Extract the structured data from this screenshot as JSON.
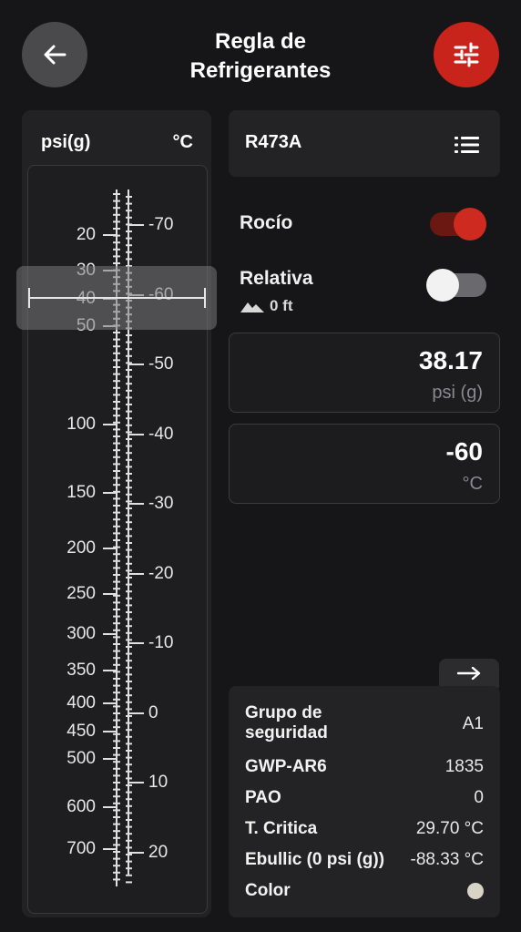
{
  "header": {
    "title_line1": "Regla de",
    "title_line2": "Refrigerantes",
    "back_icon": "arrow-left-icon",
    "settings_icon": "sliders-icon"
  },
  "ruler": {
    "pressure_unit": "psi(g)",
    "temp_unit": "°C",
    "pressure_labels": [
      "20",
      "30",
      "40",
      "50",
      "100",
      "150",
      "200",
      "250",
      "300",
      "350",
      "400",
      "450",
      "500",
      "600",
      "700"
    ],
    "temp_labels": [
      "-70",
      "-60",
      "-50",
      "-40",
      "-30",
      "-20",
      "-10",
      "0",
      "10",
      "20"
    ]
  },
  "refrigerant": {
    "name": "R473A",
    "list_icon": "list-icon"
  },
  "toggles": {
    "dew_label": "Rocío",
    "dew_on": true,
    "relative_label": "Relativa",
    "relative_on": false,
    "altitude_icon": "mountain-icon",
    "altitude": "0 ft"
  },
  "readings": {
    "pressure_value": "38.17",
    "pressure_unit": "psi (g)",
    "temp_value": "-60",
    "temp_unit": "°C"
  },
  "info": {
    "expand_icon": "arrow-right-icon",
    "safety_group_line1": "Grupo de",
    "safety_group_line2": "seguridad",
    "safety_group": "A1",
    "gwp_label": "GWP-AR6",
    "gwp": "1835",
    "odp_label": "PAO",
    "odp": "0",
    "critical_label": "T. Critica",
    "critical": "29.70 °C",
    "boiling_label": "Ebullic (0 psi (g))",
    "boiling": "-88.33 °C",
    "color_label": "Color",
    "color": "#d8d3c4"
  },
  "colors": {
    "accent": "#c8241c",
    "background": "#161618"
  }
}
